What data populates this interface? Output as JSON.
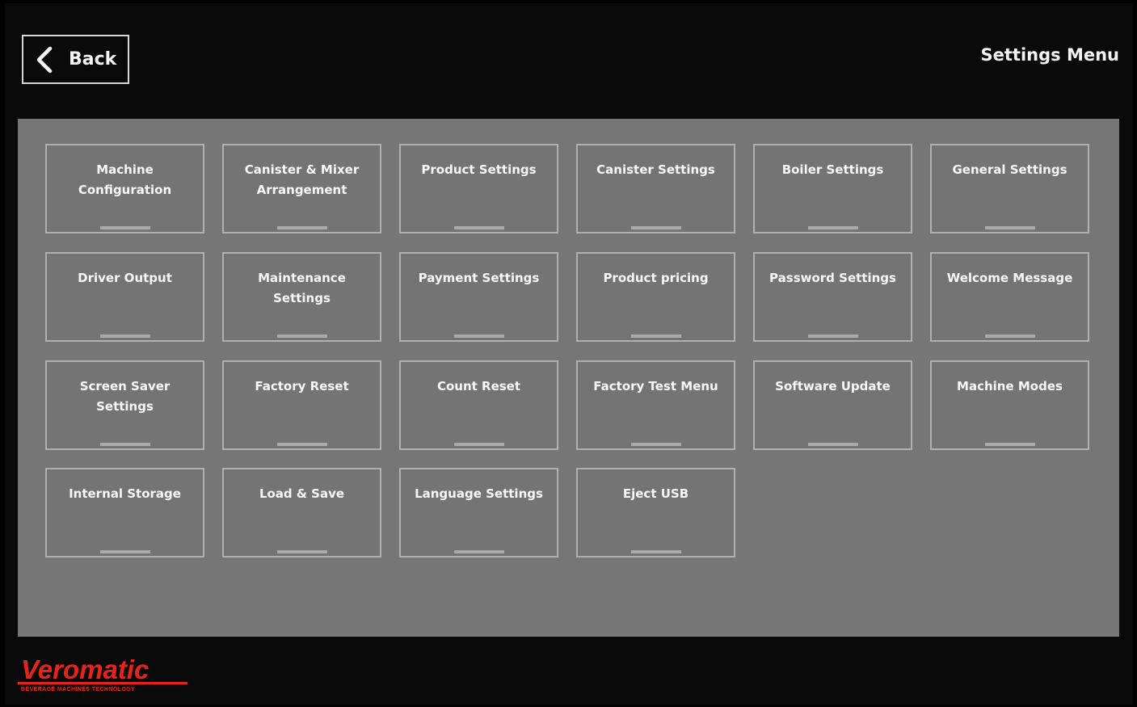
{
  "header": {
    "back_label": "Back",
    "title": "Settings Menu"
  },
  "menu": {
    "tiles": [
      {
        "label": "Machine Configuration"
      },
      {
        "label": "Canister & Mixer Arrangement"
      },
      {
        "label": "Product Settings"
      },
      {
        "label": "Canister Settings"
      },
      {
        "label": "Boiler Settings"
      },
      {
        "label": "General Settings"
      },
      {
        "label": "Driver Output"
      },
      {
        "label": "Maintenance Settings"
      },
      {
        "label": "Payment Settings"
      },
      {
        "label": "Product pricing"
      },
      {
        "label": "Password Settings"
      },
      {
        "label": "Welcome Message"
      },
      {
        "label": "Screen Saver Settings"
      },
      {
        "label": "Factory Reset"
      },
      {
        "label": "Count Reset"
      },
      {
        "label": "Factory Test Menu"
      },
      {
        "label": "Software Update"
      },
      {
        "label": "Machine Modes"
      },
      {
        "label": "Internal Storage"
      },
      {
        "label": "Load & Save"
      },
      {
        "label": "Language Settings"
      },
      {
        "label": "Eject USB"
      }
    ]
  },
  "brand": {
    "logo_text": "Veromatic",
    "tagline": "BEVERAGE MACHINES TECHNOLOGY",
    "color": "#e8231b"
  },
  "icons": {
    "back": "chevron-left-icon"
  }
}
